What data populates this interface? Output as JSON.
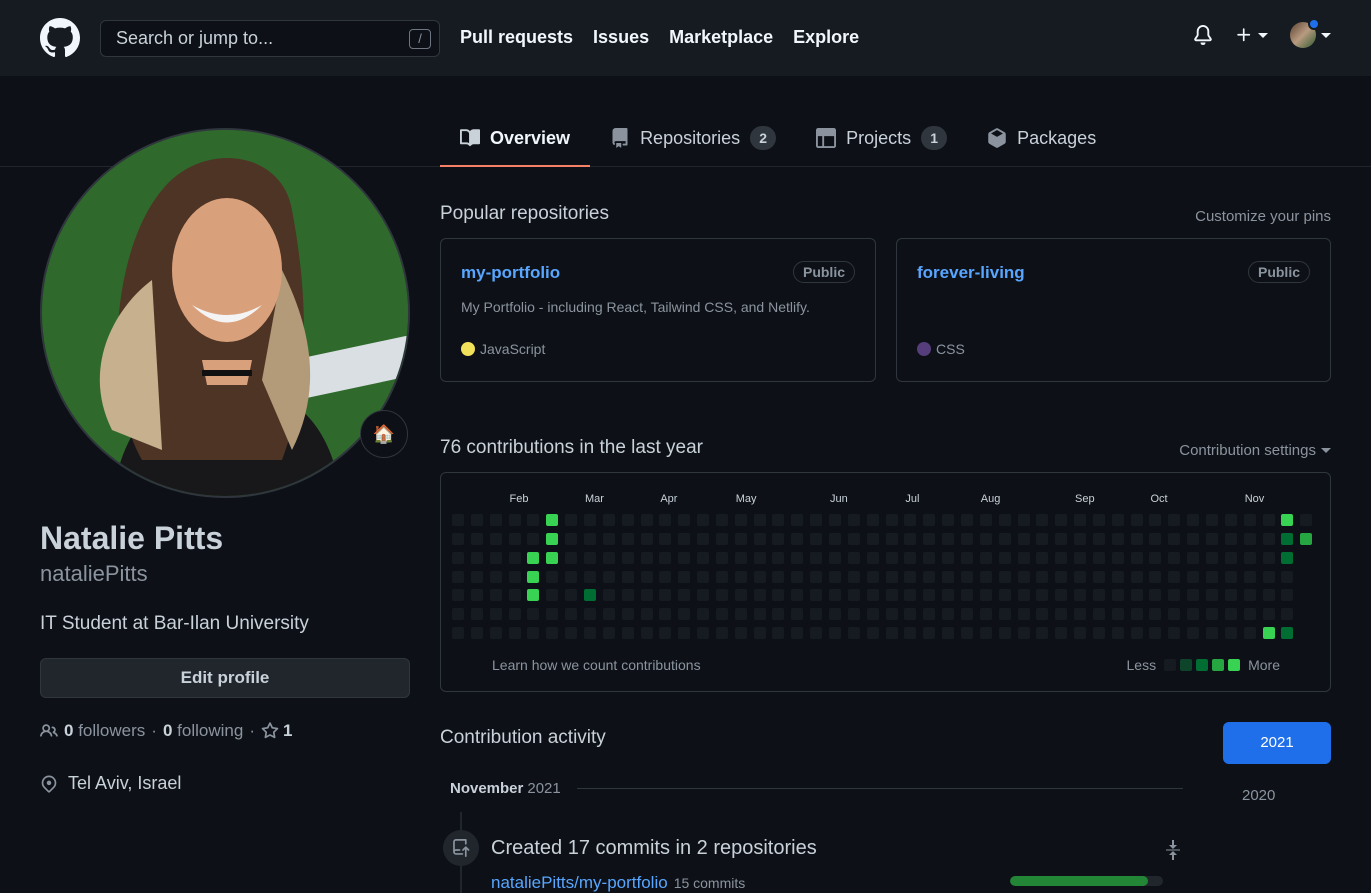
{
  "header": {
    "search_placeholder": "Search or jump to...",
    "search_shortcut": "/",
    "nav": [
      "Pull requests",
      "Issues",
      "Marketplace",
      "Explore"
    ],
    "icons": [
      "github-logo",
      "bell-icon",
      "plus-icon",
      "avatar"
    ]
  },
  "tabs": [
    {
      "label": "Overview",
      "icon": "book-icon",
      "active": true
    },
    {
      "label": "Repositories",
      "icon": "repo-icon",
      "count": "2"
    },
    {
      "label": "Projects",
      "icon": "table-icon",
      "count": "1"
    },
    {
      "label": "Packages",
      "icon": "package-icon"
    }
  ],
  "profile": {
    "fullname": "Natalie Pitts",
    "username": "nataliePitts",
    "bio": "IT Student at Bar-Ilan University",
    "edit_button": "Edit profile",
    "followers_count": "0",
    "followers_label": "followers",
    "following_count": "0",
    "following_label": "following",
    "stars_count": "1",
    "location": "Tel Aviv, Israel",
    "status_emoji": "🏠"
  },
  "popular": {
    "title": "Popular repositories",
    "customize": "Customize your pins",
    "repos": [
      {
        "name": "my-portfolio",
        "visibility": "Public",
        "description": "My Portfolio - including React, Tailwind CSS, and Netlify.",
        "language": "JavaScript",
        "lang_color": "#f1e05a"
      },
      {
        "name": "forever-living",
        "visibility": "Public",
        "description": "",
        "language": "CSS",
        "lang_color": "#563d7c"
      }
    ]
  },
  "contributions": {
    "title": "76 contributions in the last year",
    "settings": "Contribution settings",
    "months": [
      "Feb",
      "Mar",
      "Apr",
      "May",
      "Jun",
      "Jul",
      "Aug",
      "Sep",
      "Oct",
      "Nov"
    ],
    "learn": "Learn how we count contributions",
    "less": "Less",
    "more": "More",
    "level_colors": [
      "#161b22",
      "#0e4429",
      "#006d32",
      "#26a641",
      "#39d353"
    ],
    "active_cells": [
      {
        "week": 5,
        "day": 0,
        "level": 4
      },
      {
        "week": 5,
        "day": 1,
        "level": 4
      },
      {
        "week": 5,
        "day": 2,
        "level": 4
      },
      {
        "week": 4,
        "day": 2,
        "level": 4
      },
      {
        "week": 4,
        "day": 3,
        "level": 4
      },
      {
        "week": 4,
        "day": 4,
        "level": 4
      },
      {
        "week": 7,
        "day": 4,
        "level": 2
      },
      {
        "week": 44,
        "day": 0,
        "level": 4
      },
      {
        "week": 44,
        "day": 1,
        "level": 2
      },
      {
        "week": 44,
        "day": 2,
        "level": 2
      },
      {
        "week": 45,
        "day": 1,
        "level": 3
      },
      {
        "week": 43,
        "day": 6,
        "level": 4
      },
      {
        "week": 44,
        "day": 6,
        "level": 2
      }
    ]
  },
  "activity": {
    "title": "Contribution activity",
    "years": [
      "2021",
      "2020"
    ],
    "month": "November",
    "month_year": "2021",
    "summary": "Created 17 commits in 2 repositories",
    "repo": "nataliePitts/my-portfolio",
    "repo_commits": "15 commits",
    "repo_share": 0.9
  }
}
